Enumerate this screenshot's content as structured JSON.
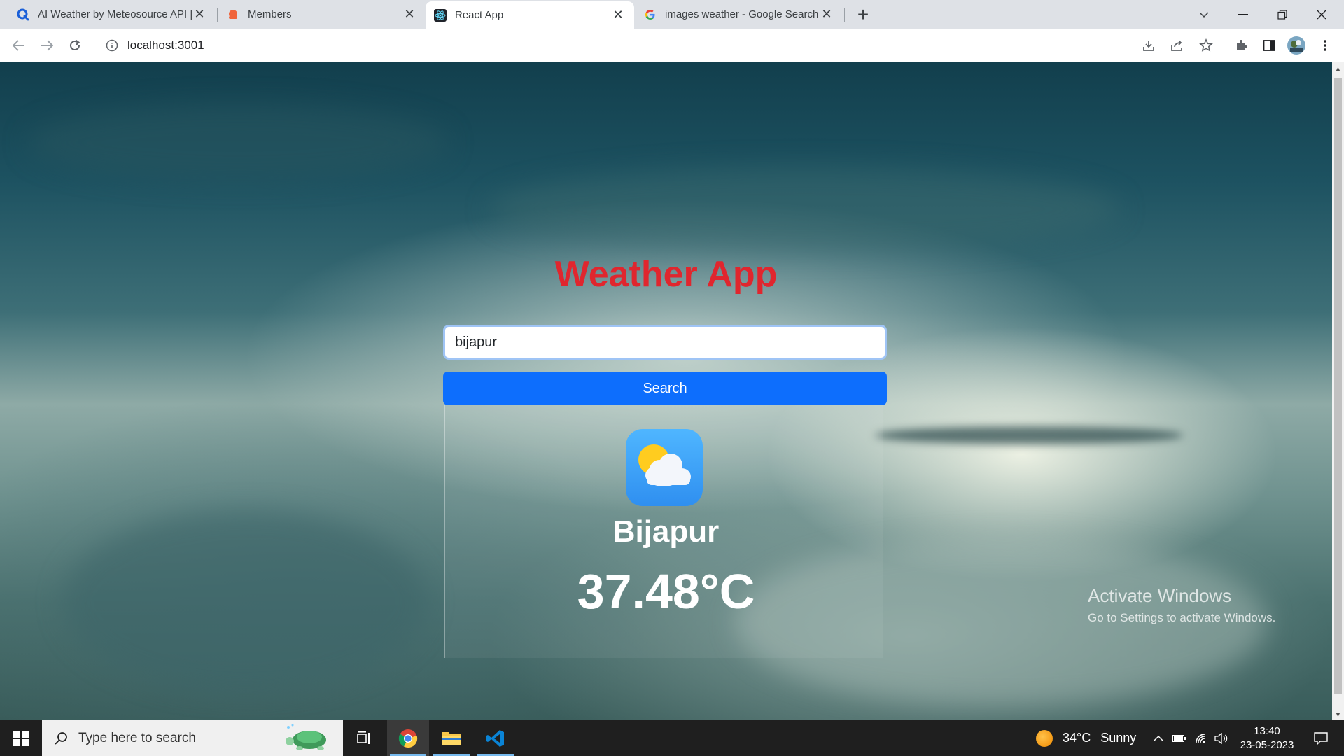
{
  "browser": {
    "tabs": [
      {
        "title": "AI Weather by Meteosource API | ",
        "favicon": "meteosource-q-icon",
        "active": false
      },
      {
        "title": "Members",
        "favicon": "members-orange-icon",
        "active": false
      },
      {
        "title": "React App",
        "favicon": "react-icon",
        "active": true
      },
      {
        "title": "images weather - Google Search",
        "favicon": "google-g-icon",
        "active": false
      }
    ],
    "new_tab_glyph": "+",
    "url": "localhost:3001"
  },
  "app": {
    "title": "Weather App",
    "search": {
      "value": "bijapur",
      "button_label": "Search"
    },
    "result": {
      "city": "Bijapur",
      "temperature": "37.48°C",
      "icon": "sun-behind-cloud-icon"
    }
  },
  "watermark": {
    "line1": "Activate Windows",
    "line2": "Go to Settings to activate Windows."
  },
  "taskbar": {
    "search_placeholder": "Type here to search",
    "weather": {
      "temp": "34°C",
      "condition": "Sunny"
    },
    "time": "13:40",
    "date": "23-05-2023"
  },
  "colors": {
    "title_red": "#e0262e",
    "button_blue": "#0d6efd",
    "input_focus_border": "#9fc4f5"
  }
}
